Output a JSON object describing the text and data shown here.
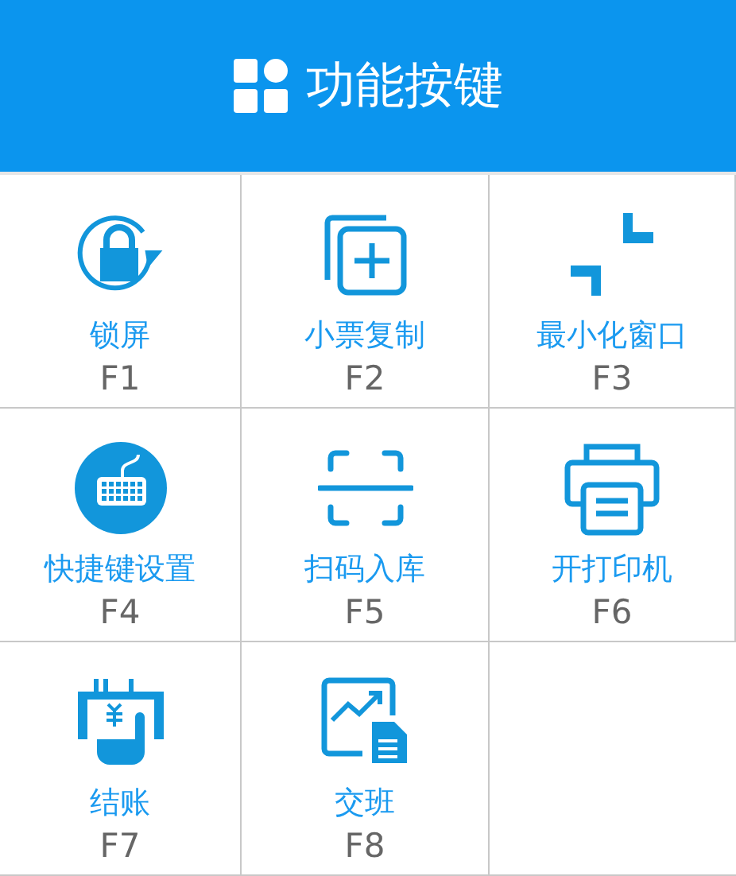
{
  "header": {
    "title": "功能按键"
  },
  "keys": [
    {
      "label": "锁屏",
      "shortcut": "F1"
    },
    {
      "label": "小票复制",
      "shortcut": "F2"
    },
    {
      "label": "最小化窗口",
      "shortcut": "F3"
    },
    {
      "label": "快捷键设置",
      "shortcut": "F4"
    },
    {
      "label": "扫码入库",
      "shortcut": "F5"
    },
    {
      "label": "开打印机",
      "shortcut": "F6"
    },
    {
      "label": "结账",
      "shortcut": "F7"
    },
    {
      "label": "交班",
      "shortcut": "F8"
    }
  ]
}
